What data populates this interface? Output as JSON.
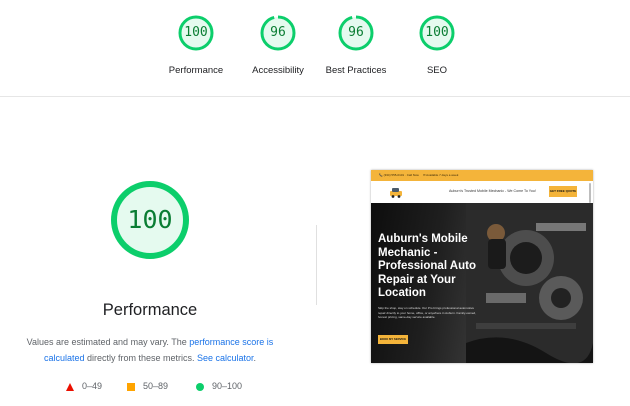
{
  "summary": [
    {
      "score": "100",
      "label": "Performance",
      "fraction": 1.0
    },
    {
      "score": "96",
      "label": "Accessibility",
      "fraction": 0.96
    },
    {
      "score": "96",
      "label": "Best Practices",
      "fraction": 0.96
    },
    {
      "score": "100",
      "label": "SEO",
      "fraction": 1.0
    }
  ],
  "main": {
    "score": "100",
    "fraction": 1.0,
    "title": "Performance",
    "desc_text1": "Values are estimated and may vary. The ",
    "desc_link1": "performance score is calculated",
    "desc_text2": " directly from these metrics. ",
    "desc_link2": "See calculator",
    "desc_text3": "."
  },
  "legend": {
    "fail": "0–49",
    "average": "50–89",
    "pass": "90–100"
  },
  "colors": {
    "pass": "#0cce6b",
    "pass_text": "#0a7d33",
    "pass_bg": "#e5faef",
    "average": "#ffa400",
    "fail": "#eb0f00",
    "link": "#1a73e8",
    "site_accent": "#f4b43a"
  },
  "screenshot": {
    "topbar_left": "📞 (334) 555-0101 · Call Now",
    "topbar_right": "✉ Available 7 days a week",
    "tagline": "Auburn's Trusted Mobile Mechanic - We Come To You!",
    "cta_top": "GET FREE QUOTE",
    "hero_title": "Auburn's Mobile Mechanic - Professional Auto Repair at Your Location",
    "hero_text": "Skip the shop, stay on schedule. Our Pro brings professional automotive repair directly to your home, office, or anywhere in Auburn. Family-owned, honest pricing, same-day service available.",
    "hero_button": "BOOK MY SERVICE"
  }
}
